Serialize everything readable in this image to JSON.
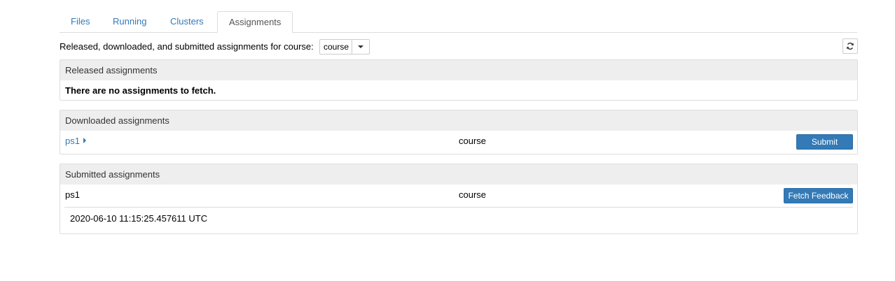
{
  "tabs": [
    {
      "label": "Files"
    },
    {
      "label": "Running"
    },
    {
      "label": "Clusters"
    },
    {
      "label": "Assignments"
    }
  ],
  "toolbar": {
    "label": "Released, downloaded, and submitted assignments for course:",
    "course_selected": "course",
    "refresh_icon": "refresh-icon"
  },
  "released": {
    "title": "Released assignments",
    "empty_message": "There are no assignments to fetch."
  },
  "downloaded": {
    "title": "Downloaded assignments",
    "rows": [
      {
        "name": "ps1",
        "course": "course",
        "action": "Submit"
      }
    ]
  },
  "submitted": {
    "title": "Submitted assignments",
    "rows": [
      {
        "name": "ps1",
        "course": "course",
        "action": "Fetch Feedback",
        "timestamp": "2020-06-10 11:15:25.457611 UTC"
      }
    ]
  },
  "colors": {
    "link": "#337ab7",
    "primary_button": "#337ab7",
    "panel_header": "#eeeeee"
  }
}
